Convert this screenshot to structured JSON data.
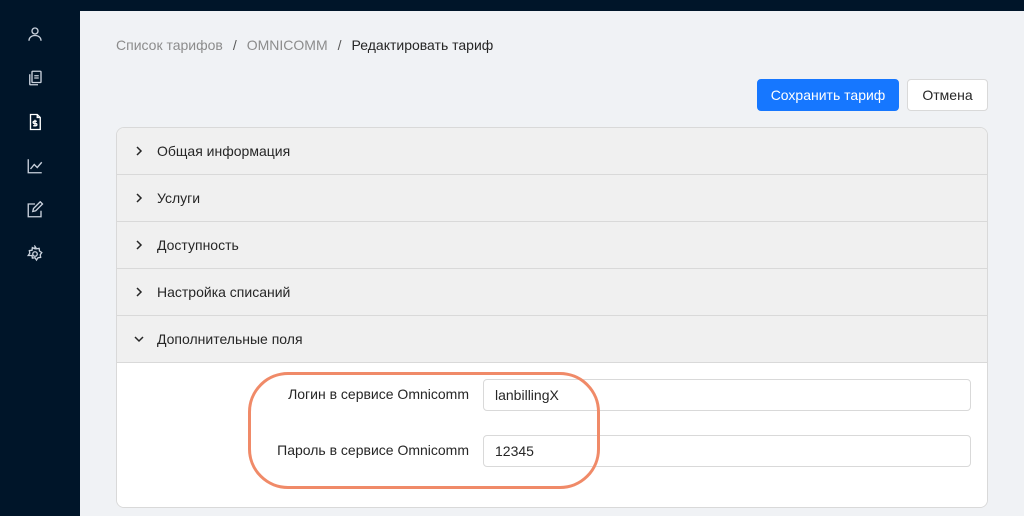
{
  "sidebar": {
    "items": [
      {
        "icon": "user-icon"
      },
      {
        "icon": "copy-icon"
      },
      {
        "icon": "file-dollar-icon"
      },
      {
        "icon": "line-chart-icon"
      },
      {
        "icon": "edit-square-icon"
      },
      {
        "icon": "gear-icon"
      }
    ]
  },
  "breadcrumb": {
    "items": [
      "Список тарифов",
      "OMNICOMM",
      "Редактировать тариф"
    ],
    "separator": "/"
  },
  "actions": {
    "save_label": "Сохранить тариф",
    "cancel_label": "Отмена"
  },
  "panels": [
    {
      "title": "Общая информация",
      "expanded": false
    },
    {
      "title": "Услуги",
      "expanded": false
    },
    {
      "title": "Доступность",
      "expanded": false
    },
    {
      "title": "Настройка списаний",
      "expanded": false
    },
    {
      "title": "Дополнительные поля",
      "expanded": true
    }
  ],
  "extra_fields": {
    "login_label": "Логин в сервисе Omnicomm",
    "login_value": "lanbillingX",
    "password_label": "Пароль в сервисе Omnicomm",
    "password_value": "12345"
  },
  "colors": {
    "primary": "#1677ff",
    "sidebar_bg": "#001529",
    "highlight": "#f08a68"
  }
}
